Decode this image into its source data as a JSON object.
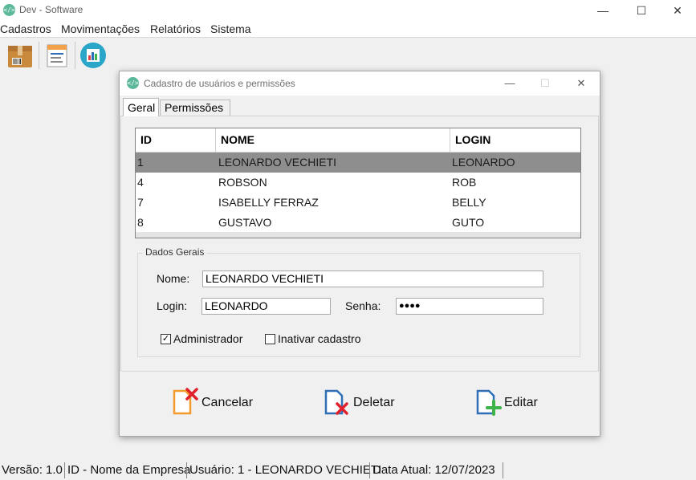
{
  "window": {
    "title": "Dev - Software",
    "minimize_glyph": "—",
    "maximize_glyph": "☐",
    "close_glyph": "✕"
  },
  "menu": [
    "Cadastros",
    "Movimentações",
    "Relatórios",
    "Sistema"
  ],
  "toolbar": {
    "icons": [
      "box-barcode-icon",
      "document-list-icon",
      "bar-chart-icon"
    ]
  },
  "dialog": {
    "title": "Cadastro de usuários e permissões",
    "tabs": [
      "Geral",
      "Permissões"
    ],
    "table": {
      "headers": [
        "ID",
        "NOME",
        "LOGIN"
      ],
      "rows": [
        [
          "1",
          "LEONARDO VECHIETI",
          "LEONARDO"
        ],
        [
          "4",
          "ROBSON",
          "ROB"
        ],
        [
          "7",
          "ISABELLY FERRAZ",
          "BELLY"
        ],
        [
          "8",
          "GUSTAVO",
          "GUTO"
        ]
      ],
      "selected_row": 0
    },
    "group": {
      "legend": "Dados Gerais",
      "nome_label": "Nome:",
      "nome_value": "LEONARDO VECHIETI",
      "login_label": "Login:",
      "login_value": "LEONARDO",
      "senha_label": "Senha:",
      "senha_value": "●●●●",
      "admin_label": "Administrador",
      "admin_checked": true,
      "inativar_label": "Inativar cadastro",
      "inativar_checked": false
    },
    "buttons": {
      "cancelar": "Cancelar",
      "deletar": "Deletar",
      "editar": "Editar"
    },
    "colors": {
      "selection": "#8e8e8e",
      "cancel_red": "#e0202a",
      "edit_green": "#3cb44a",
      "doc_orange": "#f29a2e",
      "doc_blue": "#2f6fb6"
    }
  },
  "status": {
    "versao": "Versão: 1.0",
    "empresa": "ID - Nome da Empresa",
    "usuario": "Usuário: 1 - LEONARDO VECHIETI",
    "data": "Data Atual:  12/07/2023"
  }
}
